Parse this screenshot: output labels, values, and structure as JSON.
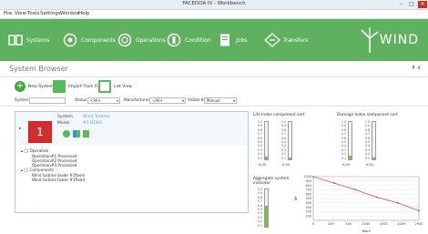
{
  "window": {
    "title": "FACEDOA IV - Workbench",
    "controls": [
      "–",
      "□",
      "✕"
    ]
  },
  "menu": [
    "File",
    "View",
    "Tools",
    "Settings",
    "Window",
    "Help"
  ],
  "ribbon": {
    "items": [
      {
        "label": "Systems",
        "icon": "systems-icon"
      },
      {
        "label": "Components",
        "icon": "components-icon"
      },
      {
        "label": "Operations",
        "icon": "operations-icon"
      },
      {
        "label": "Condition",
        "icon": "condition-icon"
      },
      {
        "label": "Jobs",
        "icon": "jobs-icon"
      },
      {
        "label": "Transfers",
        "icon": "transfers-icon"
      }
    ],
    "logo_text": "WIND",
    "accent": "#5fb05f"
  },
  "system_browser": {
    "title": "System Browser",
    "pin": "⇞ x",
    "toolbar": {
      "new_system": "New System",
      "import": "Import From File",
      "list_view": "List View"
    },
    "filters": {
      "system_label": "System",
      "status_label": "Status",
      "status_value": "<All>",
      "manufacturer_label": "Manufacturer",
      "manufacturer_value": "<All>",
      "visible_by_label": "Visible by",
      "visible_by_value": "Manual"
    }
  },
  "panel": {
    "turbine_number": "1",
    "system_label": "System",
    "system_value": "Wind Turbine",
    "model_label": "Model",
    "model_value": "#1 B1W1",
    "tree": [
      "▴ ◯ Operation",
      "Operation#1    Processed",
      "Operation#2    Processed",
      "Operation#3    Processed",
      "▴ ◯ Components",
      "Wind turbine blade #1fixed",
      "Wind turbine tower #1fixed"
    ]
  },
  "life_index": {
    "title": "Life Index component sort",
    "ticks": [
      "1.0",
      "0.9",
      "0.8",
      "0.7",
      "0.6",
      "0.5",
      "0.4",
      "0.3",
      "0.2",
      "0.1"
    ],
    "gauges": [
      {
        "value": 0.08,
        "label": "0.00"
      },
      {
        "value": 0.05,
        "label": "0.00"
      }
    ]
  },
  "damage_index": {
    "title": "Damage Index component sort",
    "ticks": [
      "1.0",
      "0.9",
      "0.8",
      "0.7",
      "0.6",
      "0.5",
      "0.4",
      "0.3",
      "0.2",
      "0.1"
    ],
    "gauges": [
      {
        "value": 0.1,
        "label": "0.00"
      },
      {
        "value": 0.05,
        "label": "0.00"
      }
    ]
  },
  "aggregate": {
    "title": "Aggregate system",
    "subtitle": "indicator",
    "ticks": [
      "1.0",
      "0.9",
      "0.8",
      "0.7",
      "0.6",
      "0.5",
      "0.4",
      "0.3",
      "0.2",
      "0.1"
    ],
    "gauge_value": 0.55
  },
  "chart_data": {
    "type": "line",
    "title": "",
    "xlabel": "Years",
    "ylabel": "RP",
    "x": [
      0,
      500,
      1000,
      1500,
      2000,
      2500
    ],
    "y": [
      1000,
      850,
      700,
      530,
      400,
      220
    ],
    "xlim": [
      0,
      2500
    ],
    "ylim": [
      0,
      1000
    ],
    "xticks": [
      "0",
      "200",
      "500",
      "1000",
      "1500",
      "2000",
      "2500"
    ],
    "yticks": [
      "1000",
      "900",
      "800",
      "700",
      "600",
      "500",
      "400",
      "300",
      "200",
      "100"
    ],
    "series_color": "#e06060",
    "grid": true
  }
}
